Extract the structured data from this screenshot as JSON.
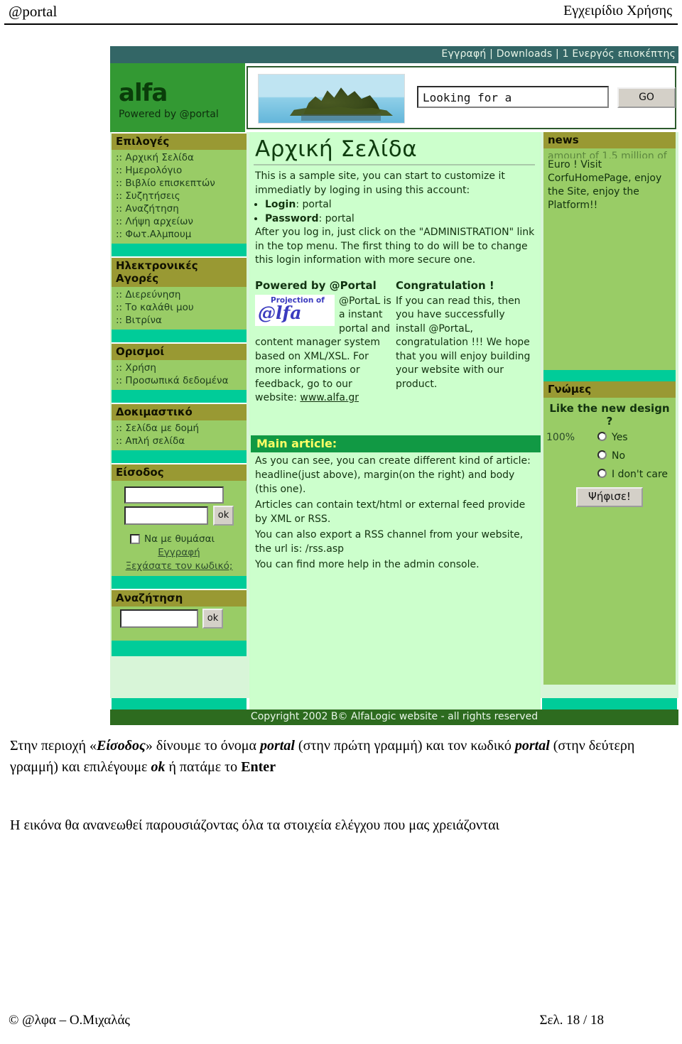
{
  "doc": {
    "header_left": "@portal",
    "header_right": "Εγχειρίδιο Χρήσης",
    "footer_left": "© @λφα – Ο.Μιχαλάς",
    "footer_right": "Σελ. 18 / 18"
  },
  "screenshot": {
    "topbar": {
      "register": "Εγγραφή",
      "sep1": "|",
      "downloads": "Downloads",
      "sep2": "|",
      "visitors": "1 Ενεργός επισκέπτης"
    },
    "brand": {
      "name": "alfa",
      "tagline": "Powered by @portal"
    },
    "search": {
      "value": "Looking for a",
      "placeholder": "Looking for a",
      "go_label": "GO"
    },
    "sidebar": {
      "blocks": [
        {
          "title": "Επιλογές",
          "items": [
            ":: Αρχική Σελίδα",
            ":: Ημερολόγιο",
            ":: Βιβλίο επισκεπτών",
            ":: Συζητήσεις",
            ":: Αναζήτηση",
            ":: Λήψη αρχείων",
            ":: Φωτ.Αλμπουμ"
          ]
        },
        {
          "title": "Ηλεκτρονικές Αγορές",
          "items": [
            ":: Διερεύνηση",
            ":: Το καλάθι μου",
            ":: Βιτρίνα"
          ]
        },
        {
          "title": "Ορισμοί",
          "items": [
            ":: Χρήση",
            ":: Προσωπικά δεδομένα"
          ]
        },
        {
          "title": "Δοκιμαστικό",
          "items": [
            ":: Σελίδα με δομή",
            ":: Απλή σελίδα"
          ]
        }
      ],
      "login": {
        "title": "Είσοδος",
        "username_value": "",
        "password_value": "",
        "ok_label": "ok",
        "remember_label": "Να με θυμάσαι",
        "register_link": "Εγγραφή",
        "forgot_link": "Ξεχάσατε τον κωδικό;"
      },
      "search_block": {
        "title": "Αναζήτηση",
        "value": "",
        "ok_label": "ok"
      }
    },
    "main": {
      "title": "Αρχική Σελίδα",
      "intro": "This is a sample site, you can start to customize it immediatly by loging in using this account:",
      "bullet_login_label": "Login",
      "bullet_login_value": ": portal",
      "bullet_password_label": "Password",
      "bullet_password_value": ": portal",
      "after": "After you log in, just click on the \"ADMINISTRATION\" link in the top menu. The first thing to do will be to change this login information with more secure one.",
      "powered": {
        "heading": "Powered by @Portal",
        "logo_top": "Projection of",
        "logo_main": "@lfa",
        "text": "@PortaL is a instant portal and content manager system based on XML/XSL. For more informations or feedback, go to our website: ",
        "link": "www.alfa.gr"
      },
      "congrats": {
        "heading": "Congratulation !",
        "text": "If you can read this, then you have successfully install @PortaL, congratulation !!! We hope that you will enjoy building your website with our product."
      },
      "article": {
        "heading": "Main article:",
        "lines": [
          "As you can see, you can create different kind of article: headline(just above), margin(on the right) and body (this one).",
          "Articles can contain text/html or external feed provide by XML or RSS.",
          "You can also export a RSS channel from your website, the url is: /rss.asp",
          "You can find more help in the admin console."
        ]
      }
    },
    "news": {
      "title": "news",
      "clipped_line": "amount of 1,5 million of",
      "text": "Euro ! Visit CorfuHomePage, enjoy the Site, enjoy the Platform!!"
    },
    "poll": {
      "title": "Γνώμες",
      "question": "Like the new design ?",
      "options": [
        {
          "pct": "100%",
          "label": "Yes"
        },
        {
          "pct": "",
          "label": "No"
        },
        {
          "pct": "",
          "label": "I don't care"
        }
      ],
      "vote_label": "Ψήφισε!"
    },
    "copyright": "Copyright 2002 B© AlfaLogic website - all rights reserved"
  },
  "prose": {
    "line1_a": "Στην περιοχή «",
    "line1_b": "Είσοδος",
    "line1_c": "» δίνουμε το όνομα  ",
    "line1_d": "portal",
    "line1_e": " (στην πρώτη γραμμή) και τον κωδικό ",
    "line2_a": "portal",
    "line2_b": " (στην δεύτερη γραμμή) και επιλέγουμε ",
    "line2_c": "ok",
    "line2_d": " ή πατάμε το ",
    "line2_e": "Enter",
    "para2": "Η εικόνα θα ανανεωθεί παρουσιάζοντας όλα τα στοιχεία ελέγχου που μας χρειάζονται"
  },
  "colors": {
    "topstrip": "#336666",
    "brand_green": "#339933",
    "sidebar_head": "#999933",
    "sidebar_body": "#99cc66",
    "separator": "#00cc99",
    "content_bg": "#ccffcc",
    "article_head": "#119944",
    "article_head_text": "#ffff66",
    "footer_bar": "#2d6b1f"
  }
}
